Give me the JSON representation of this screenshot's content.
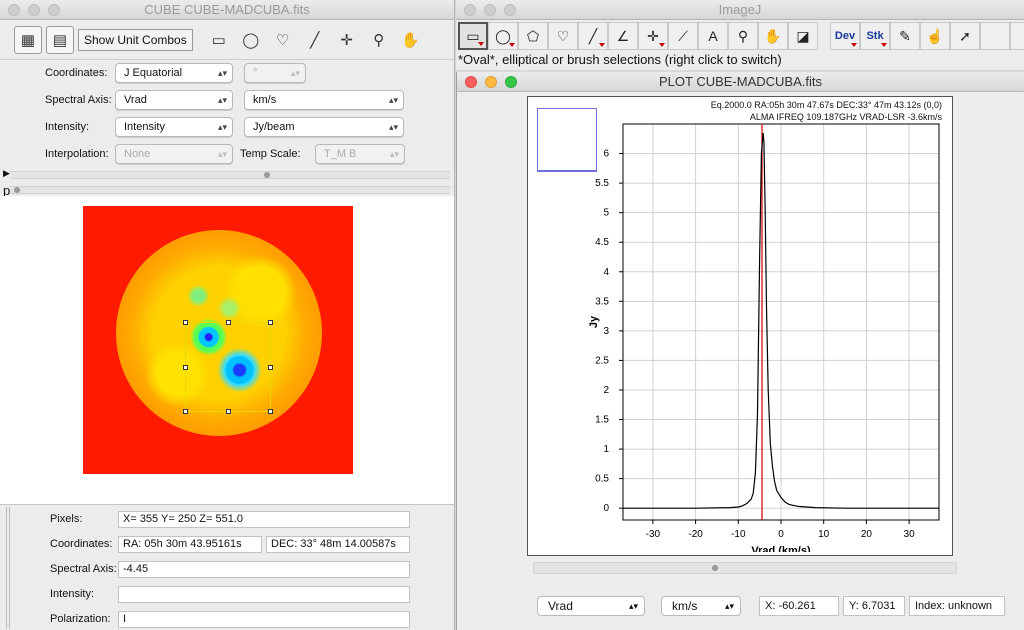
{
  "cube_window": {
    "title": "CUBE CUBE-MADCUBA.fits",
    "toolbar": {
      "show_unit_combos": "Show Unit Combos"
    },
    "form": {
      "coordinates_label": "Coordinates:",
      "coordinates_value": "J Equatorial",
      "coordinates_unit": "°",
      "spectral_axis_label": "Spectral Axis:",
      "spectral_axis_value": "Vrad",
      "spectral_axis_unit": "km/s",
      "intensity_label": "Intensity:",
      "intensity_value": "Intensity",
      "intensity_unit": "Jy/beam",
      "interpolation_label": "Interpolation:",
      "interpolation_value": "None",
      "temp_scale_label": "Temp Scale:",
      "temp_scale_value": "T_M B"
    },
    "p_marker": "p",
    "status": {
      "pixels_label": "Pixels:",
      "pixels_value": "X= 355  Y= 250  Z= 551.0",
      "coordinates_label": "Coordinates:",
      "ra_value": "RA: 05h   30m   43.95161s",
      "dec_value": "DEC: 33°   48m   14.00587s",
      "spectral_label": "Spectral Axis:",
      "spectral_value": "-4.45",
      "intensity_label": "Intensity:",
      "intensity_value": "",
      "polarization_label": "Polarization:",
      "polarization_value": "I"
    }
  },
  "imagej_window": {
    "title": "ImageJ",
    "tools": [
      "rectangle",
      "oval",
      "polygon",
      "freehand",
      "line",
      "angle",
      "point",
      "wand",
      "text",
      "zoom",
      "hand",
      "color-picker",
      "Dev",
      "Stk",
      "pencil",
      "brush",
      "arrow",
      "more"
    ],
    "dev_label": "Dev",
    "stk_label": "Stk",
    "more_label": ">>",
    "text_tool_label": "A",
    "status": "*Oval*, elliptical or brush selections (right click to switch)"
  },
  "plot_window": {
    "title": "PLOT CUBE-MADCUBA.fits",
    "header_line1": "Eq.2000.0 RA:05h 30m 47.67s DEC:33° 47m 43.12s (0,0)",
    "header_line2": "ALMA IFREQ 109.187GHz VRAD-LSR -3.6km/s",
    "axis_combo": "Vrad",
    "unit_combo": "km/s",
    "x_readout": "X: -60.261",
    "y_readout": "Y: 6.7031",
    "index_readout": "Index: unknown"
  },
  "chart_data": {
    "type": "line",
    "title": "",
    "xlabel": "Vrad (km/s)",
    "ylabel": "Jy",
    "xlim": [
      -37,
      37
    ],
    "ylim": [
      -0.2,
      6.5
    ],
    "x_ticks": [
      -30,
      -20,
      -10,
      0,
      10,
      20,
      30
    ],
    "y_ticks": [
      0,
      0.5,
      1,
      1.5,
      2,
      2.5,
      3,
      3.5,
      4,
      4.5,
      5,
      5.5,
      6
    ],
    "grid": true,
    "marker_line_x": -4.45,
    "series": [
      {
        "x": [
          -37,
          -30,
          -20,
          -12,
          -10,
          -9,
          -8,
          -7,
          -6.5,
          -6,
          -5.5,
          -5,
          -4.6,
          -4.2,
          -4,
          -3.7,
          -3.4,
          -3,
          -2.5,
          -2,
          -1.5,
          -1,
          0,
          1,
          2,
          4,
          8,
          15,
          25,
          37
        ],
        "values": [
          0.0,
          0.0,
          0.0,
          0.01,
          0.02,
          0.04,
          0.08,
          0.15,
          0.25,
          0.6,
          1.6,
          4.2,
          6.0,
          6.35,
          6.2,
          5.0,
          3.4,
          2.0,
          1.1,
          0.7,
          0.45,
          0.3,
          0.18,
          0.1,
          0.06,
          0.03,
          0.01,
          0.0,
          0.0,
          0.0
        ]
      }
    ],
    "colors": {
      "line": "#000000",
      "marker": "#cc0000",
      "grid": "#d0d0d0"
    }
  }
}
